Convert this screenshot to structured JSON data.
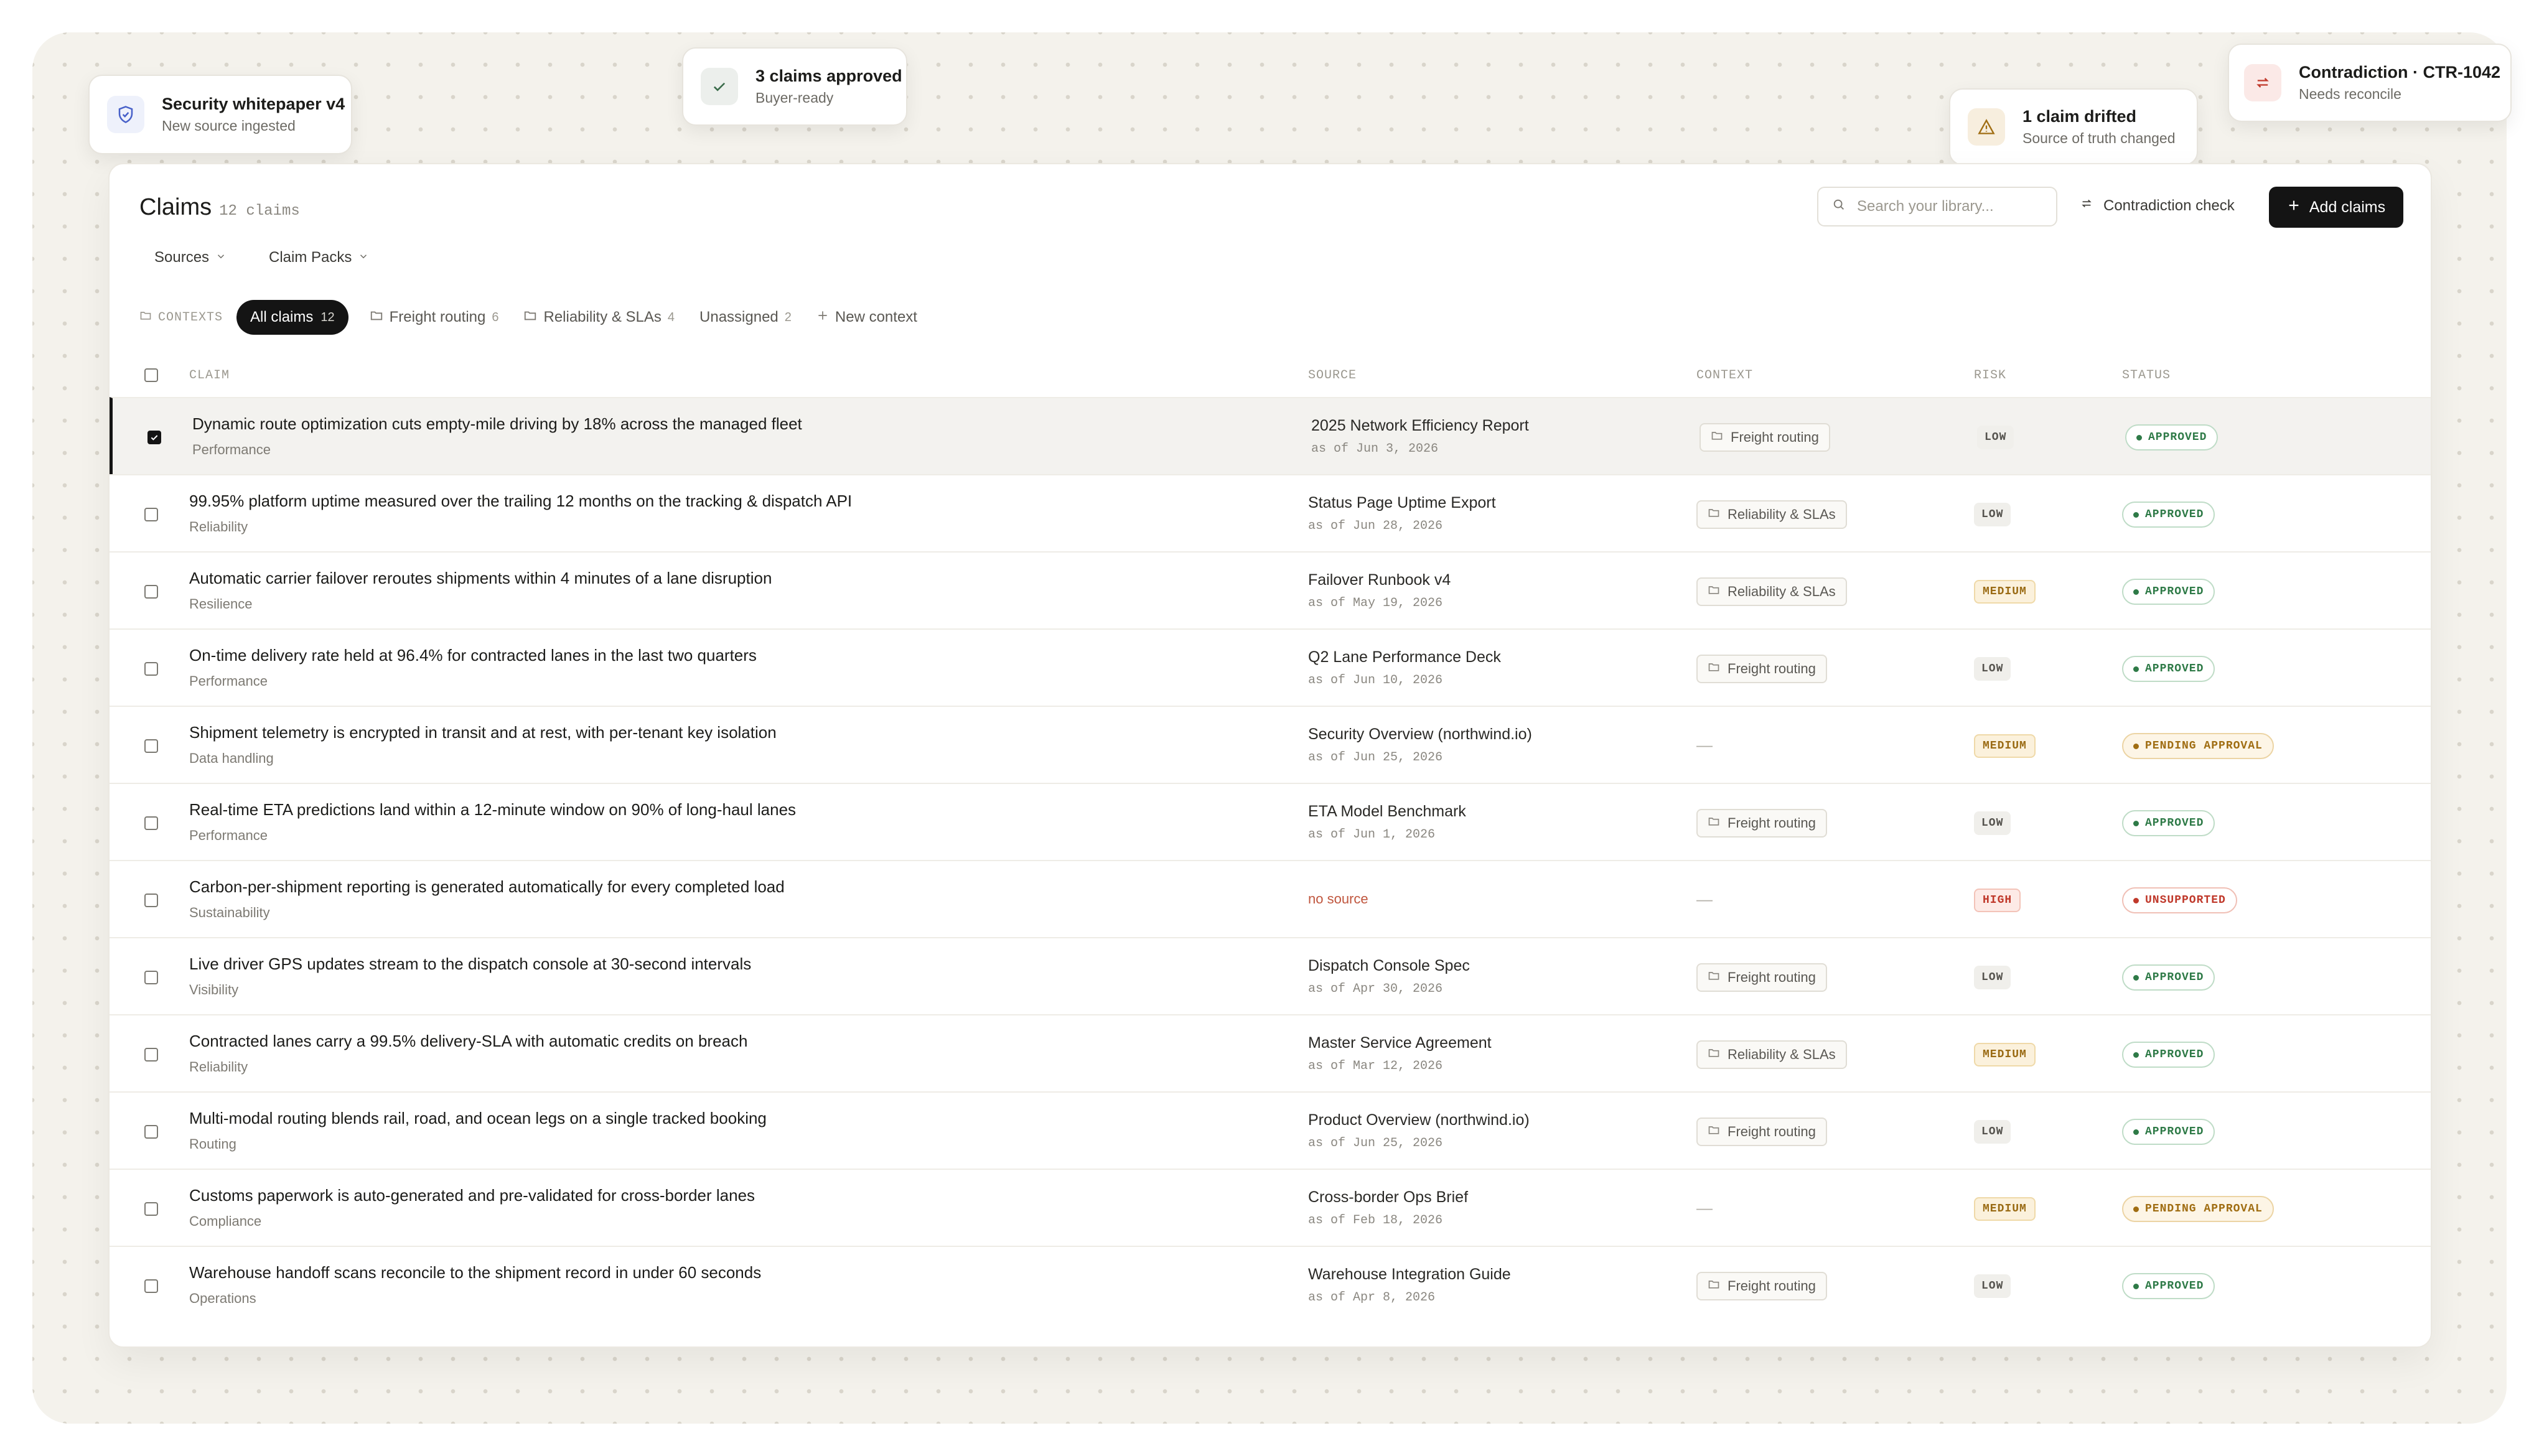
{
  "notifications": [
    {
      "title": "Security whitepaper v4",
      "subtitle": "New source ingested",
      "icon": "shield-icon"
    },
    {
      "title": "3 claims approved",
      "subtitle": "Buyer-ready",
      "icon": "check-icon"
    },
    {
      "title": "1 claim drifted",
      "subtitle": "Source of truth changed",
      "icon": "warning-icon"
    },
    {
      "title": "Contradiction · CTR-1042",
      "subtitle": "Needs reconcile",
      "icon": "swap-icon"
    }
  ],
  "header": {
    "title": "Claims",
    "count": "12 claims",
    "sources_label": "Sources",
    "claim_packs_label": "Claim Packs",
    "search_placeholder": "Search your library...",
    "contradiction_label": "Contradiction check",
    "add_label": "Add claims"
  },
  "contexts": {
    "label": "CONTEXTS",
    "active": {
      "label": "All claims",
      "count": "12"
    },
    "tabs": [
      {
        "label": "Freight routing",
        "count": "6"
      },
      {
        "label": "Reliability & SLAs",
        "count": "4"
      },
      {
        "label": "Unassigned",
        "count": "2"
      }
    ],
    "new_label": "New context"
  },
  "columns": {
    "claim": "CLAIM",
    "source": "SOURCE",
    "context": "CONTEXT",
    "risk": "RISK",
    "status": "STATUS"
  },
  "rows": [
    {
      "claim": "Dynamic route optimization cuts empty-mile driving by 18% across the managed fleet",
      "category": "Performance",
      "source": "2025 Network Efficiency Report",
      "date": "as of Jun 3, 2026",
      "context": "Freight routing",
      "risk": "LOW",
      "status": "APPROVED",
      "selected": true
    },
    {
      "claim": "99.95% platform uptime measured over the trailing 12 months on the tracking & dispatch API",
      "category": "Reliability",
      "source": "Status Page Uptime Export",
      "date": "as of Jun 28, 2026",
      "context": "Reliability & SLAs",
      "risk": "LOW",
      "status": "APPROVED"
    },
    {
      "claim": "Automatic carrier failover reroutes shipments within 4 minutes of a lane disruption",
      "category": "Resilience",
      "source": "Failover Runbook v4",
      "date": "as of May 19, 2026",
      "context": "Reliability & SLAs",
      "risk": "MEDIUM",
      "status": "APPROVED"
    },
    {
      "claim": "On-time delivery rate held at 96.4% for contracted lanes in the last two quarters",
      "category": "Performance",
      "source": "Q2 Lane Performance Deck",
      "date": "as of Jun 10, 2026",
      "context": "Freight routing",
      "risk": "LOW",
      "status": "APPROVED"
    },
    {
      "claim": "Shipment telemetry is encrypted in transit and at rest, with per-tenant key isolation",
      "category": "Data handling",
      "source": "Security Overview (northwind.io)",
      "date": "as of Jun 25, 2026",
      "context": "—",
      "risk": "MEDIUM",
      "status": "PENDING APPROVAL"
    },
    {
      "claim": "Real-time ETA predictions land within a 12-minute window on 90% of long-haul lanes",
      "category": "Performance",
      "source": "ETA Model Benchmark",
      "date": "as of Jun 1, 2026",
      "context": "Freight routing",
      "risk": "LOW",
      "status": "APPROVED"
    },
    {
      "claim": "Carbon-per-shipment reporting is generated automatically for every completed load",
      "category": "Sustainability",
      "source": "no source",
      "date": "",
      "context": "—",
      "risk": "HIGH",
      "status": "UNSUPPORTED"
    },
    {
      "claim": "Live driver GPS updates stream to the dispatch console at 30-second intervals",
      "category": "Visibility",
      "source": "Dispatch Console Spec",
      "date": "as of Apr 30, 2026",
      "context": "Freight routing",
      "risk": "LOW",
      "status": "APPROVED"
    },
    {
      "claim": "Contracted lanes carry a 99.5% delivery-SLA with automatic credits on breach",
      "category": "Reliability",
      "source": "Master Service Agreement",
      "date": "as of Mar 12, 2026",
      "context": "Reliability & SLAs",
      "risk": "MEDIUM",
      "status": "APPROVED"
    },
    {
      "claim": "Multi-modal routing blends rail, road, and ocean legs on a single tracked booking",
      "category": "Routing",
      "source": "Product Overview (northwind.io)",
      "date": "as of Jun 25, 2026",
      "context": "Freight routing",
      "risk": "LOW",
      "status": "APPROVED"
    },
    {
      "claim": "Customs paperwork is auto-generated and pre-validated for cross-border lanes",
      "category": "Compliance",
      "source": "Cross-border Ops Brief",
      "date": "as of Feb 18, 2026",
      "context": "—",
      "risk": "MEDIUM",
      "status": "PENDING APPROVAL"
    },
    {
      "claim": "Warehouse handoff scans reconcile to the shipment record in under 60 seconds",
      "category": "Operations",
      "source": "Warehouse Integration Guide",
      "date": "as of Apr 8, 2026",
      "context": "Freight routing",
      "risk": "LOW",
      "status": "APPROVED"
    }
  ]
}
